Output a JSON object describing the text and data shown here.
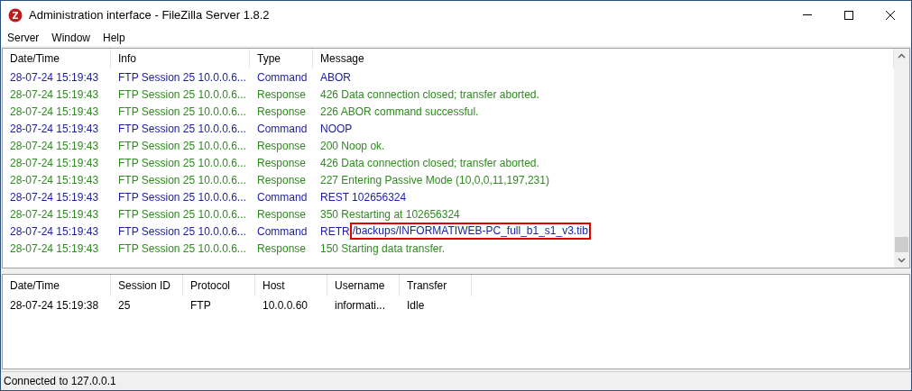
{
  "window": {
    "title": "Administration interface - FileZilla Server 1.8.2"
  },
  "menu": [
    "Server",
    "Window",
    "Help"
  ],
  "log": {
    "columns": [
      "Date/Time",
      "Info",
      "Type",
      "Message"
    ],
    "rows": [
      {
        "kind": "command",
        "date": "28-07-24 15:19:43",
        "info": "FTP Session 25 10.0.0.6...",
        "type": "Command",
        "message": "ABOR"
      },
      {
        "kind": "response",
        "date": "28-07-24 15:19:43",
        "info": "FTP Session 25 10.0.0.6...",
        "type": "Response",
        "message": "426 Data connection closed; transfer aborted."
      },
      {
        "kind": "response",
        "date": "28-07-24 15:19:43",
        "info": "FTP Session 25 10.0.0.6...",
        "type": "Response",
        "message": "226 ABOR command successful."
      },
      {
        "kind": "command",
        "date": "28-07-24 15:19:43",
        "info": "FTP Session 25 10.0.0.6...",
        "type": "Command",
        "message": "NOOP"
      },
      {
        "kind": "response",
        "date": "28-07-24 15:19:43",
        "info": "FTP Session 25 10.0.0.6...",
        "type": "Response",
        "message": "200 Noop ok."
      },
      {
        "kind": "response",
        "date": "28-07-24 15:19:43",
        "info": "FTP Session 25 10.0.0.6...",
        "type": "Response",
        "message": "426 Data connection closed; transfer aborted."
      },
      {
        "kind": "response",
        "date": "28-07-24 15:19:43",
        "info": "FTP Session 25 10.0.0.6...",
        "type": "Response",
        "message": "227 Entering Passive Mode (10,0,0,11,197,231)"
      },
      {
        "kind": "command",
        "date": "28-07-24 15:19:43",
        "info": "FTP Session 25 10.0.0.6...",
        "type": "Command",
        "message": "REST 102656324"
      },
      {
        "kind": "response",
        "date": "28-07-24 15:19:43",
        "info": "FTP Session 25 10.0.0.6...",
        "type": "Response",
        "message": "350 Restarting at 102656324"
      },
      {
        "kind": "command",
        "date": "28-07-24 15:19:43",
        "info": "FTP Session 25 10.0.0.6...",
        "type": "Command",
        "message": "RETR",
        "highlight": "/backups/INFORMATIWEB-PC_full_b1_s1_v3.tib"
      },
      {
        "kind": "response",
        "date": "28-07-24 15:19:43",
        "info": "FTP Session 25 10.0.0.6...",
        "type": "Response",
        "message": "150 Starting data transfer."
      }
    ]
  },
  "sessions": {
    "columns": [
      "Date/Time",
      "Session ID",
      "Protocol",
      "Host",
      "Username",
      "Transfer"
    ],
    "rows": [
      [
        "28-07-24 15:19:38",
        "25",
        "FTP",
        "10.0.0.60",
        "informati...",
        "Idle"
      ]
    ]
  },
  "status_bar": "Connected to 127.0.0.1"
}
